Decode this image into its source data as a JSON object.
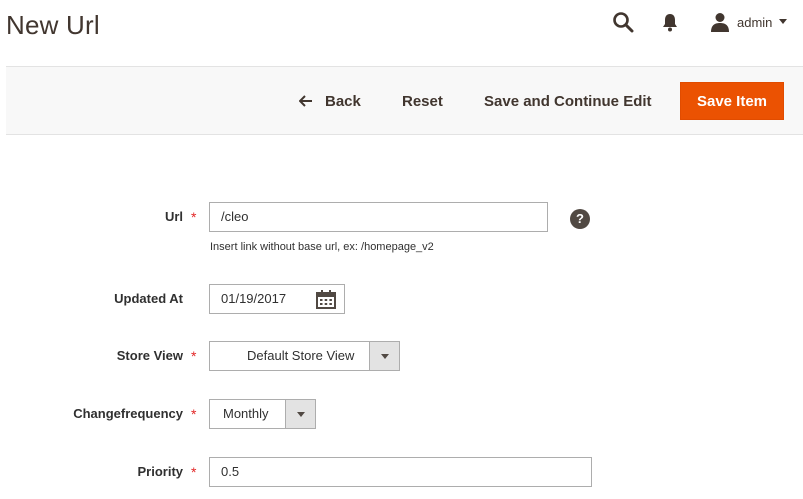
{
  "page": {
    "title": "New Url"
  },
  "header": {
    "user_name": "admin"
  },
  "actions": {
    "back_label": "Back",
    "reset_label": "Reset",
    "save_continue_label": "Save and Continue Edit",
    "save_label": "Save Item",
    "save_color": "#eb5202"
  },
  "form": {
    "url": {
      "label": "Url",
      "required": "*",
      "value": "/cleo",
      "note": "Insert link without base url, ex: /homepage_v2",
      "help": "?"
    },
    "updated_at": {
      "label": "Updated At",
      "value": "01/19/2017"
    },
    "store_view": {
      "label": "Store View",
      "required": "*",
      "value": "Default Store View"
    },
    "changefrequency": {
      "label": "Changefrequency",
      "required": "*",
      "value": "Monthly"
    },
    "priority": {
      "label": "Priority",
      "required": "*",
      "value": "0.5"
    }
  },
  "icons": [
    "search-icon",
    "bell-icon",
    "user-icon",
    "caret-down-icon",
    "arrow-left-icon",
    "calendar-icon",
    "help-icon",
    "chevron-down-icon"
  ]
}
